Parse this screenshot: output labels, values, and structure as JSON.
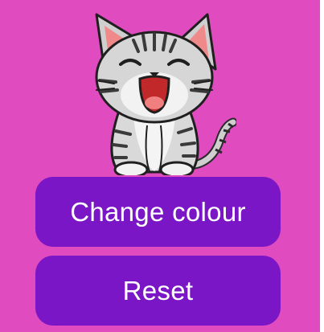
{
  "colors": {
    "background": "#e04bbf",
    "button_bg": "#7a16c6",
    "button_text": "#ffffff"
  },
  "image": {
    "icon": "cat-icon"
  },
  "buttons": {
    "change_colour_label": "Change colour",
    "reset_label": "Reset"
  }
}
